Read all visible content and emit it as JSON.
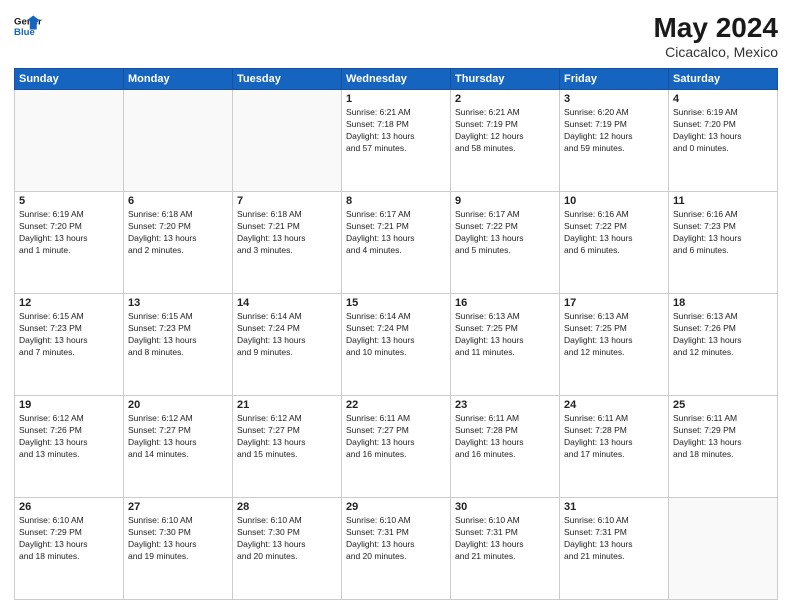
{
  "header": {
    "logo_line1": "General",
    "logo_line2": "Blue",
    "month_year": "May 2024",
    "location": "Cicacalco, Mexico"
  },
  "weekdays": [
    "Sunday",
    "Monday",
    "Tuesday",
    "Wednesday",
    "Thursday",
    "Friday",
    "Saturday"
  ],
  "weeks": [
    [
      {
        "day": "",
        "info": ""
      },
      {
        "day": "",
        "info": ""
      },
      {
        "day": "",
        "info": ""
      },
      {
        "day": "1",
        "info": "Sunrise: 6:21 AM\nSunset: 7:18 PM\nDaylight: 13 hours\nand 57 minutes."
      },
      {
        "day": "2",
        "info": "Sunrise: 6:21 AM\nSunset: 7:19 PM\nDaylight: 12 hours\nand 58 minutes."
      },
      {
        "day": "3",
        "info": "Sunrise: 6:20 AM\nSunset: 7:19 PM\nDaylight: 12 hours\nand 59 minutes."
      },
      {
        "day": "4",
        "info": "Sunrise: 6:19 AM\nSunset: 7:20 PM\nDaylight: 13 hours\nand 0 minutes."
      }
    ],
    [
      {
        "day": "5",
        "info": "Sunrise: 6:19 AM\nSunset: 7:20 PM\nDaylight: 13 hours\nand 1 minute."
      },
      {
        "day": "6",
        "info": "Sunrise: 6:18 AM\nSunset: 7:20 PM\nDaylight: 13 hours\nand 2 minutes."
      },
      {
        "day": "7",
        "info": "Sunrise: 6:18 AM\nSunset: 7:21 PM\nDaylight: 13 hours\nand 3 minutes."
      },
      {
        "day": "8",
        "info": "Sunrise: 6:17 AM\nSunset: 7:21 PM\nDaylight: 13 hours\nand 4 minutes."
      },
      {
        "day": "9",
        "info": "Sunrise: 6:17 AM\nSunset: 7:22 PM\nDaylight: 13 hours\nand 5 minutes."
      },
      {
        "day": "10",
        "info": "Sunrise: 6:16 AM\nSunset: 7:22 PM\nDaylight: 13 hours\nand 6 minutes."
      },
      {
        "day": "11",
        "info": "Sunrise: 6:16 AM\nSunset: 7:23 PM\nDaylight: 13 hours\nand 6 minutes."
      }
    ],
    [
      {
        "day": "12",
        "info": "Sunrise: 6:15 AM\nSunset: 7:23 PM\nDaylight: 13 hours\nand 7 minutes."
      },
      {
        "day": "13",
        "info": "Sunrise: 6:15 AM\nSunset: 7:23 PM\nDaylight: 13 hours\nand 8 minutes."
      },
      {
        "day": "14",
        "info": "Sunrise: 6:14 AM\nSunset: 7:24 PM\nDaylight: 13 hours\nand 9 minutes."
      },
      {
        "day": "15",
        "info": "Sunrise: 6:14 AM\nSunset: 7:24 PM\nDaylight: 13 hours\nand 10 minutes."
      },
      {
        "day": "16",
        "info": "Sunrise: 6:13 AM\nSunset: 7:25 PM\nDaylight: 13 hours\nand 11 minutes."
      },
      {
        "day": "17",
        "info": "Sunrise: 6:13 AM\nSunset: 7:25 PM\nDaylight: 13 hours\nand 12 minutes."
      },
      {
        "day": "18",
        "info": "Sunrise: 6:13 AM\nSunset: 7:26 PM\nDaylight: 13 hours\nand 12 minutes."
      }
    ],
    [
      {
        "day": "19",
        "info": "Sunrise: 6:12 AM\nSunset: 7:26 PM\nDaylight: 13 hours\nand 13 minutes."
      },
      {
        "day": "20",
        "info": "Sunrise: 6:12 AM\nSunset: 7:27 PM\nDaylight: 13 hours\nand 14 minutes."
      },
      {
        "day": "21",
        "info": "Sunrise: 6:12 AM\nSunset: 7:27 PM\nDaylight: 13 hours\nand 15 minutes."
      },
      {
        "day": "22",
        "info": "Sunrise: 6:11 AM\nSunset: 7:27 PM\nDaylight: 13 hours\nand 16 minutes."
      },
      {
        "day": "23",
        "info": "Sunrise: 6:11 AM\nSunset: 7:28 PM\nDaylight: 13 hours\nand 16 minutes."
      },
      {
        "day": "24",
        "info": "Sunrise: 6:11 AM\nSunset: 7:28 PM\nDaylight: 13 hours\nand 17 minutes."
      },
      {
        "day": "25",
        "info": "Sunrise: 6:11 AM\nSunset: 7:29 PM\nDaylight: 13 hours\nand 18 minutes."
      }
    ],
    [
      {
        "day": "26",
        "info": "Sunrise: 6:10 AM\nSunset: 7:29 PM\nDaylight: 13 hours\nand 18 minutes."
      },
      {
        "day": "27",
        "info": "Sunrise: 6:10 AM\nSunset: 7:30 PM\nDaylight: 13 hours\nand 19 minutes."
      },
      {
        "day": "28",
        "info": "Sunrise: 6:10 AM\nSunset: 7:30 PM\nDaylight: 13 hours\nand 20 minutes."
      },
      {
        "day": "29",
        "info": "Sunrise: 6:10 AM\nSunset: 7:31 PM\nDaylight: 13 hours\nand 20 minutes."
      },
      {
        "day": "30",
        "info": "Sunrise: 6:10 AM\nSunset: 7:31 PM\nDaylight: 13 hours\nand 21 minutes."
      },
      {
        "day": "31",
        "info": "Sunrise: 6:10 AM\nSunset: 7:31 PM\nDaylight: 13 hours\nand 21 minutes."
      },
      {
        "day": "",
        "info": ""
      }
    ]
  ]
}
